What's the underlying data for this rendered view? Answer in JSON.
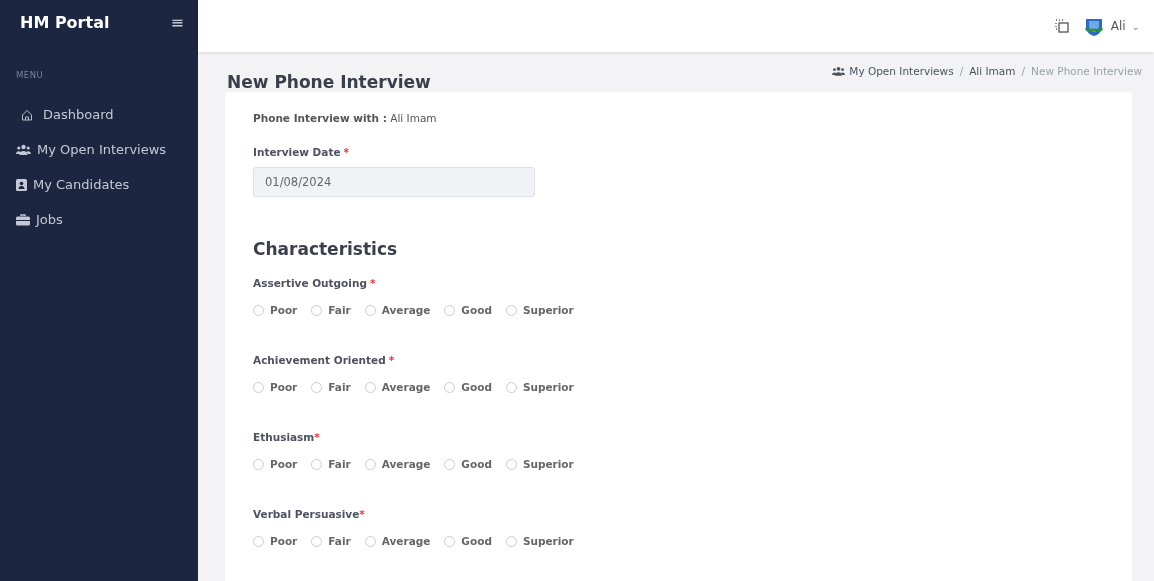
{
  "sidebar": {
    "title": "HM Portal",
    "menu_button": "≡",
    "section_label": "MENU",
    "items": [
      {
        "label": "Dashboard",
        "selected": false
      },
      {
        "label": "My Open Interviews",
        "selected": false
      },
      {
        "label": "My Candidates",
        "selected": false
      },
      {
        "label": "Jobs",
        "selected": false
      }
    ]
  },
  "topbar": {
    "user_name": "Ali",
    "user_caret": "⌄"
  },
  "page": {
    "title": "New Phone Interview",
    "breadcrumb": [
      {
        "kind": "link",
        "label": "My Open Interviews"
      },
      {
        "kind": "separator",
        "label": "/"
      },
      {
        "kind": "link",
        "label": "Ali Imam"
      },
      {
        "kind": "separator",
        "label": "/"
      },
      {
        "kind": "current",
        "label": "New Phone Interview"
      }
    ]
  },
  "form": {
    "intro": "**Phone Interview with :** Ali Imam",
    "date_field": {
      "label": "Interview Date",
      "required_mark": "*",
      "value": "01/08/2024"
    },
    "section_title": "Characteristics",
    "characteristics": [
      {
        "label": "Assertive Outgoing",
        "required_mark": "*",
        "options": [
          {
            "label": "Poor",
            "selected": false
          },
          {
            "label": "Fair",
            "selected": false
          },
          {
            "label": "Average",
            "selected": false
          },
          {
            "label": "Good",
            "selected": false
          },
          {
            "label": "Superior",
            "selected": false
          }
        ]
      },
      {
        "label": "Achievement Oriented",
        "required_mark": "*",
        "options": [
          {
            "label": "Poor",
            "selected": false
          },
          {
            "label": "Fair",
            "selected": false
          },
          {
            "label": "Average",
            "selected": false
          },
          {
            "label": "Good",
            "selected": false
          },
          {
            "label": "Superior",
            "selected": false
          }
        ]
      },
      {
        "label": "Ethusiasm",
        "required_mark": "*",
        "options": [
          {
            "label": "Poor",
            "selected": false
          },
          {
            "label": "Fair",
            "selected": false
          },
          {
            "label": "Average",
            "selected": false
          },
          {
            "label": "Good",
            "selected": false
          },
          {
            "label": "Superior",
            "selected": false
          }
        ]
      },
      {
        "label": "Verbal Persuasive",
        "required_mark": "*",
        "options": [
          {
            "label": "Poor",
            "selected": false
          },
          {
            "label": "Fair",
            "selected": false
          },
          {
            "label": "Average",
            "selected": false
          },
          {
            "label": "Good",
            "selected": false
          },
          {
            "label": "Superior",
            "selected": false
          }
        ]
      }
    ]
  }
}
